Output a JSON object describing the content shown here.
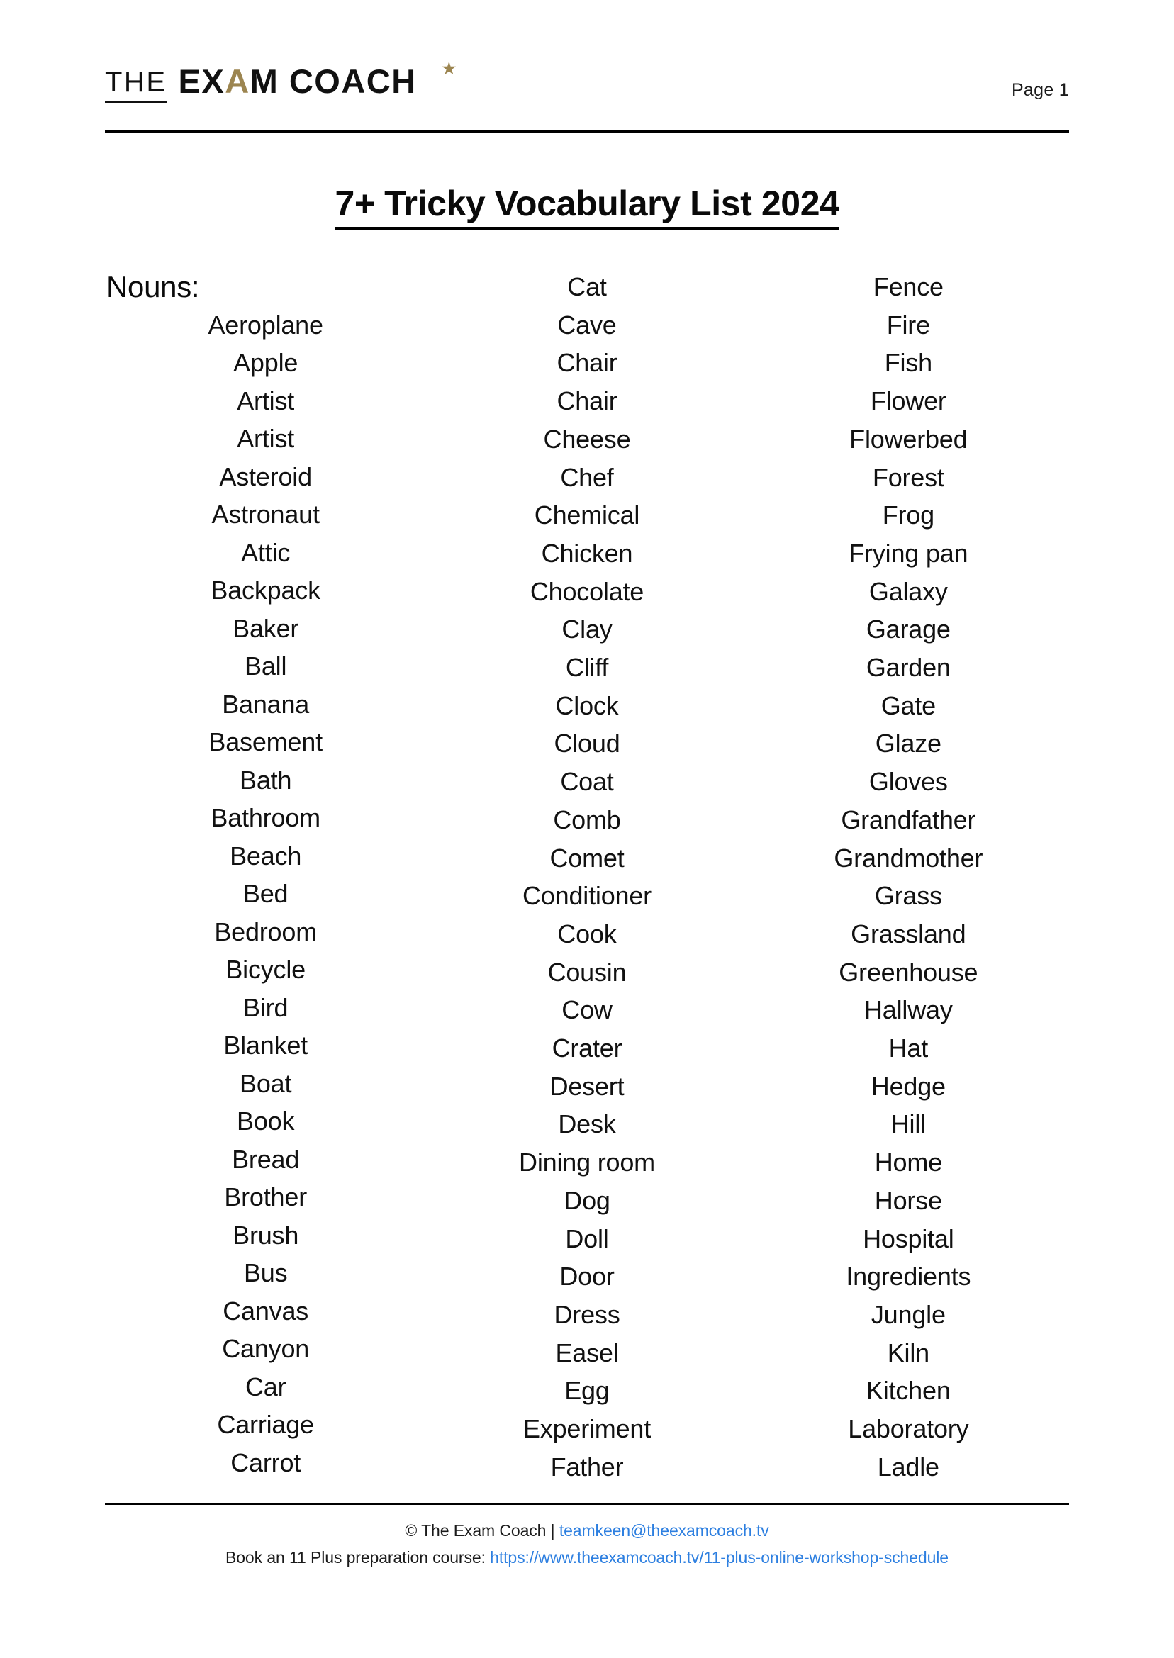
{
  "header": {
    "logo": {
      "the": "THE",
      "main_before": "EX",
      "main_accent": "A",
      "main_after": "M COACH",
      "accent_color": "#9c8550",
      "star_glyph": "★"
    },
    "page_label": "Page 1"
  },
  "title": "7+ Tricky Vocabulary List 2024",
  "columns": [
    {
      "label": "Nouns:",
      "words": [
        "Aeroplane",
        "Apple",
        "Artist",
        "Artist",
        "Asteroid",
        "Astronaut",
        "Attic",
        "Backpack",
        "Baker",
        "Ball",
        "Banana",
        "Basement",
        "Bath",
        "Bathroom",
        "Beach",
        "Bed",
        "Bedroom",
        "Bicycle",
        "Bird",
        "Blanket",
        "Boat",
        "Book",
        "Bread",
        "Brother",
        "Brush",
        "Bus",
        "Canvas",
        "Canyon",
        "Car",
        "Carriage",
        "Carrot"
      ]
    },
    {
      "label": "",
      "words": [
        "Cat",
        "Cave",
        "Chair",
        "Chair",
        "Cheese",
        "Chef",
        "Chemical",
        "Chicken",
        "Chocolate",
        "Clay",
        "Cliff",
        "Clock",
        "Cloud",
        "Coat",
        "Comb",
        "Comet",
        "Conditioner",
        "Cook",
        "Cousin",
        "Cow",
        "Crater",
        "Desert",
        "Desk",
        "Dining room",
        "Dog",
        "Doll",
        "Door",
        "Dress",
        "Easel",
        "Egg",
        "Experiment",
        "Father"
      ]
    },
    {
      "label": "",
      "words": [
        "Fence",
        "Fire",
        "Fish",
        "Flower",
        "Flowerbed",
        "Forest",
        "Frog",
        "Frying pan",
        "Galaxy",
        "Garage",
        "Garden",
        "Gate",
        "Glaze",
        "Gloves",
        "Grandfather",
        "Grandmother",
        "Grass",
        "Grassland",
        "Greenhouse",
        "Hallway",
        "Hat",
        "Hedge",
        "Hill",
        "Home",
        "Horse",
        "Hospital",
        "Ingredients",
        "Jungle",
        "Kiln",
        "Kitchen",
        "Laboratory",
        "Ladle"
      ]
    }
  ],
  "footer": {
    "copyright": "© The Exam Coach | ",
    "email": "teamkeen@theexamcoach.tv",
    "course_prefix": "Book an 11 Plus preparation course: ",
    "course_url": "https://www.theexamcoach.tv/11-plus-online-workshop-schedule",
    "link_color": "#2d7fe0"
  }
}
